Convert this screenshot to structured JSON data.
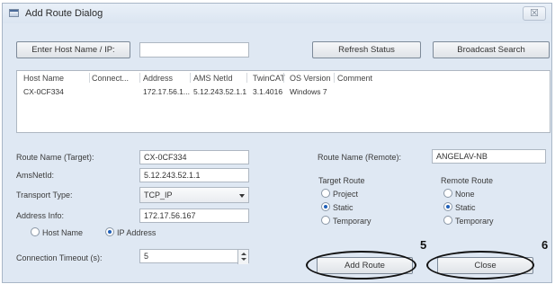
{
  "window": {
    "title": "Add Route Dialog",
    "close_glyph": "☒"
  },
  "top": {
    "enter_host_label": "Enter Host Name / IP:",
    "host_input_value": "",
    "refresh_label": "Refresh Status",
    "broadcast_label": "Broadcast Search"
  },
  "list": {
    "columns": [
      "Host Name",
      "Connect...",
      "Address",
      "AMS NetId",
      "TwinCAT",
      "OS Version",
      "Comment"
    ],
    "rows": [
      {
        "host": "CX-0CF334",
        "connect": "",
        "address": "172.17.56.1...",
        "netid": "5.12.243.52.1.1",
        "twincat": "3.1.4016",
        "os": "Windows 7",
        "comment": ""
      }
    ]
  },
  "form": {
    "route_name_label": "Route Name (Target):",
    "route_name_value": "CX-0CF334",
    "amsnetid_label": "AmsNetId:",
    "amsnetid_value": "5.12.243.52.1.1",
    "transport_label": "Transport Type:",
    "transport_value": "TCP_IP",
    "address_label": "Address Info:",
    "address_value": "172.17.56.167",
    "hostname_radio": "Host Name",
    "ipaddress_radio": "IP Address",
    "timeout_label": "Connection Timeout (s):",
    "timeout_value": "5",
    "remote_name_label": "Route Name (Remote):",
    "remote_name_value": "ANGELAV-NB"
  },
  "target_route": {
    "title": "Target Route",
    "options": [
      "Project",
      "Static",
      "Temporary"
    ],
    "selected": "Static"
  },
  "remote_route": {
    "title": "Remote Route",
    "options": [
      "None",
      "Static",
      "Temporary"
    ],
    "selected": "Static"
  },
  "buttons": {
    "add_route": "Add Route",
    "close": "Close"
  },
  "callouts": {
    "add_route_number": "5",
    "close_number": "6"
  }
}
